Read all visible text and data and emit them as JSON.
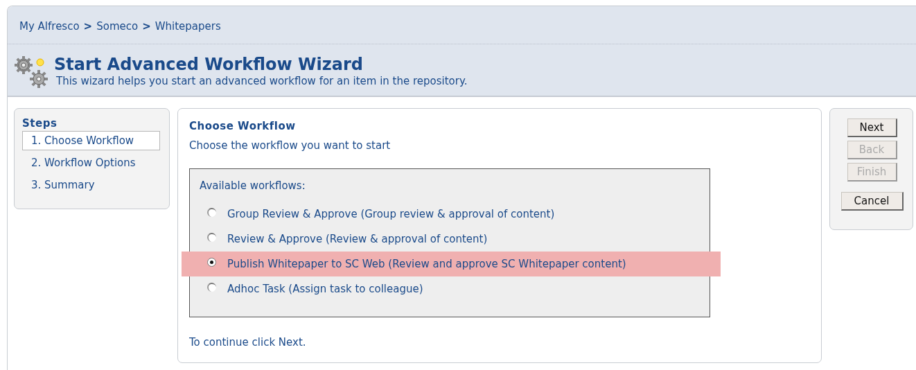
{
  "breadcrumb": [
    {
      "kind": "link",
      "text": "My Alfresco"
    },
    {
      "kind": "separator",
      "text": ">"
    },
    {
      "kind": "link",
      "text": "Someco"
    },
    {
      "kind": "separator",
      "text": ">"
    },
    {
      "kind": "link",
      "text": "Whitepapers"
    }
  ],
  "header": {
    "title": "Start Advanced Workflow Wizard",
    "subtitle": "This wizard helps you start an advanced workflow for an item in the repository."
  },
  "steps": {
    "title": "Steps",
    "items": [
      {
        "label": "1. Choose Workflow",
        "selected": true
      },
      {
        "label": "2. Workflow Options",
        "selected": false
      },
      {
        "label": "3. Summary",
        "selected": false
      }
    ]
  },
  "content": {
    "heading": "Choose Workflow",
    "description": "Choose the workflow you want to start",
    "group_label": "Available workflows:",
    "options": [
      {
        "label": "Group Review & Approve (Group review & approval of content)",
        "selected": false
      },
      {
        "label": "Review & Approve (Review & approval of content)",
        "selected": false
      },
      {
        "label": "Publish Whitepaper to SC Web (Review and approve SC Whitepaper content)",
        "selected": true
      },
      {
        "label": "Adhoc Task (Assign task to colleague)",
        "selected": false
      }
    ],
    "footer": "To continue click Next."
  },
  "buttons": [
    {
      "label": "Next",
      "disabled": false
    },
    {
      "label": "Back",
      "disabled": true
    },
    {
      "label": "Finish",
      "disabled": true
    },
    {
      "label": "Cancel",
      "disabled": false
    }
  ]
}
